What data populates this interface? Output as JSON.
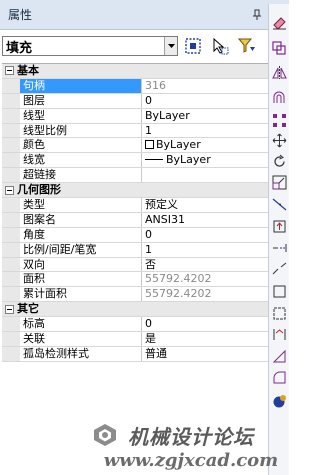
{
  "panel": {
    "title": "属性"
  },
  "selection": {
    "value": "填充"
  },
  "sections": [
    {
      "title": "基本",
      "rows": [
        {
          "name": "句柄",
          "value": "316",
          "selected": true,
          "readonly": true
        },
        {
          "name": "图层",
          "value": "0"
        },
        {
          "name": "线型",
          "value": "ByLayer"
        },
        {
          "name": "线型比例",
          "value": "1"
        },
        {
          "name": "颜色",
          "value": "ByLayer"
        },
        {
          "name": "线宽",
          "value": "ByLayer"
        },
        {
          "name": "超链接",
          "value": ""
        }
      ]
    },
    {
      "title": "几何图形",
      "rows": [
        {
          "name": "类型",
          "value": "预定义"
        },
        {
          "name": "图案名",
          "value": "ANSI31"
        },
        {
          "name": "角度",
          "value": "0"
        },
        {
          "name": "比例/间距/笔宽",
          "value": "1"
        },
        {
          "name": "双向",
          "value": "否"
        },
        {
          "name": "面积",
          "value": "55792.4202",
          "readonly": true
        },
        {
          "name": "累计面积",
          "value": "55792.4202",
          "readonly": true
        }
      ]
    },
    {
      "title": "其它",
      "rows": [
        {
          "name": "标高",
          "value": "0"
        },
        {
          "name": "关联",
          "value": "是"
        },
        {
          "name": "孤岛检测样式",
          "value": "普通"
        }
      ]
    }
  ],
  "toolbar_icons": [
    "eraser-icon",
    "copy-icon",
    "mirror-icon",
    "offset-icon",
    "array-icon",
    "move-icon",
    "rotate-icon",
    "scale-icon",
    "stretch-icon",
    "trim-icon",
    "extend-icon",
    "break-icon",
    "join-icon",
    "chamfer-icon",
    "fillet-icon",
    "explode-icon"
  ],
  "watermark": {
    "line1": "机械设计论坛",
    "line2": "www.zgjxcad.com"
  },
  "colors": {
    "selection": "#3399ff",
    "section_bg": "#e8e8e8",
    "title_bg": "#dce6f2"
  }
}
